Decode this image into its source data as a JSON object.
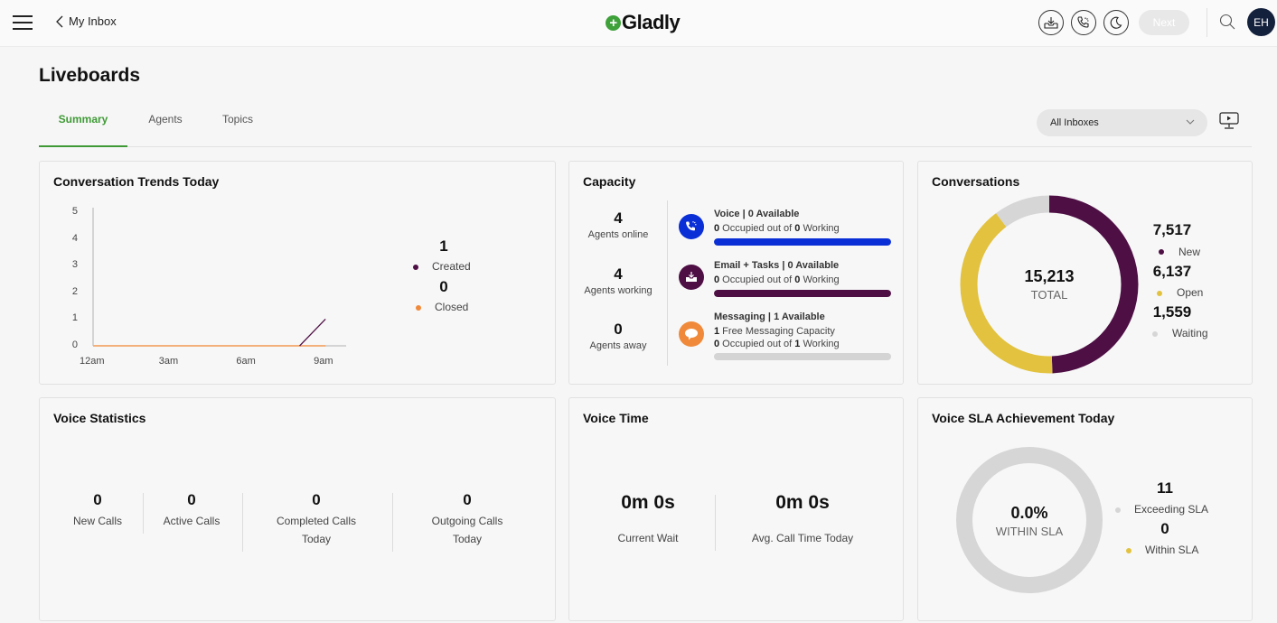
{
  "header": {
    "back_label": "My Inbox",
    "logo_text": "Gladly",
    "next_label": "Next",
    "avatar_initials": "EH",
    "icons": [
      "inbox-download-icon",
      "phone-status-icon",
      "moon-icon",
      "search-icon"
    ]
  },
  "page": {
    "title": "Liveboards",
    "tabs": [
      {
        "label": "Summary",
        "active": true
      },
      {
        "label": "Agents",
        "active": false
      },
      {
        "label": "Topics",
        "active": false
      }
    ],
    "inbox_select": "All Inboxes"
  },
  "trends": {
    "title": "Conversation Trends Today",
    "legend": [
      {
        "value": "1",
        "label": "Created",
        "color": "#4e0f44"
      },
      {
        "value": "0",
        "label": "Closed",
        "color": "#f08a3a"
      }
    ]
  },
  "chart_data": {
    "type": "line",
    "title": "Conversation Trends Today",
    "x_ticks": [
      "12am",
      "3am",
      "6am",
      "9am"
    ],
    "y_ticks": [
      "0",
      "1",
      "2",
      "3",
      "4",
      "5"
    ],
    "ylim": [
      0,
      5
    ],
    "xlim_hours": [
      0,
      10
    ],
    "series": [
      {
        "name": "Created",
        "color": "#4e0f44",
        "points": [
          [
            8,
            0
          ],
          [
            9,
            1
          ]
        ]
      },
      {
        "name": "Closed",
        "color": "#f3b07a",
        "points": [
          [
            0,
            0
          ],
          [
            9,
            0
          ]
        ]
      }
    ]
  },
  "capacity": {
    "title": "Capacity",
    "agents": [
      {
        "value": "4",
        "label": "Agents online"
      },
      {
        "value": "4",
        "label": "Agents working"
      },
      {
        "value": "0",
        "label": "Agents away"
      }
    ],
    "channels": [
      {
        "name": "Voice",
        "available": "0 Available",
        "lines": [
          {
            "a": "0",
            "t1": " Occupied out of ",
            "b": "0",
            "t2": " Working"
          }
        ],
        "color": "#0a2fd6",
        "bar_fill": 1.0
      },
      {
        "name": "Email + Tasks",
        "available": "0 Available",
        "lines": [
          {
            "a": "0",
            "t1": " Occupied out of ",
            "b": "0",
            "t2": " Working"
          }
        ],
        "color": "#4e0f44",
        "bar_fill": 1.0
      },
      {
        "name": "Messaging",
        "available": "1 Available",
        "lines": [
          {
            "a": "1",
            "t1": " Free Messaging Capacity",
            "b": "",
            "t2": ""
          },
          {
            "a": "0",
            "t1": " Occupied out of ",
            "b": "1",
            "t2": " Working"
          }
        ],
        "color": "#f08a3a",
        "bar_fill": 0.0
      }
    ]
  },
  "conversations": {
    "title": "Conversations",
    "total": "15,213",
    "total_label": "TOTAL",
    "segments": [
      {
        "label": "New",
        "value": 7517,
        "display": "7,517",
        "color": "#4e0f44"
      },
      {
        "label": "Open",
        "value": 6137,
        "display": "6,137",
        "color": "#e2c23e"
      },
      {
        "label": "Waiting",
        "value": 1559,
        "display": "1,559",
        "color": "#d6d6d6"
      }
    ]
  },
  "voice_stats": {
    "title": "Voice Statistics",
    "items": [
      {
        "value": "0",
        "label": "New Calls"
      },
      {
        "value": "0",
        "label": "Active Calls"
      },
      {
        "value": "0",
        "label": "Completed Calls Today"
      },
      {
        "value": "0",
        "label": "Outgoing Calls Today"
      }
    ]
  },
  "voice_time": {
    "title": "Voice Time",
    "items": [
      {
        "value": "0m 0s",
        "label": "Current Wait"
      },
      {
        "value": "0m 0s",
        "label": "Avg. Call Time Today"
      }
    ]
  },
  "sla": {
    "title": "Voice SLA Achievement Today",
    "percent": "0.0%",
    "percent_label": "WITHIN SLA",
    "legend": [
      {
        "value": "11",
        "label": "Exceeding SLA",
        "color": "#d6d6d6"
      },
      {
        "value": "0",
        "label": "Within SLA",
        "color": "#e2c23e"
      }
    ]
  }
}
